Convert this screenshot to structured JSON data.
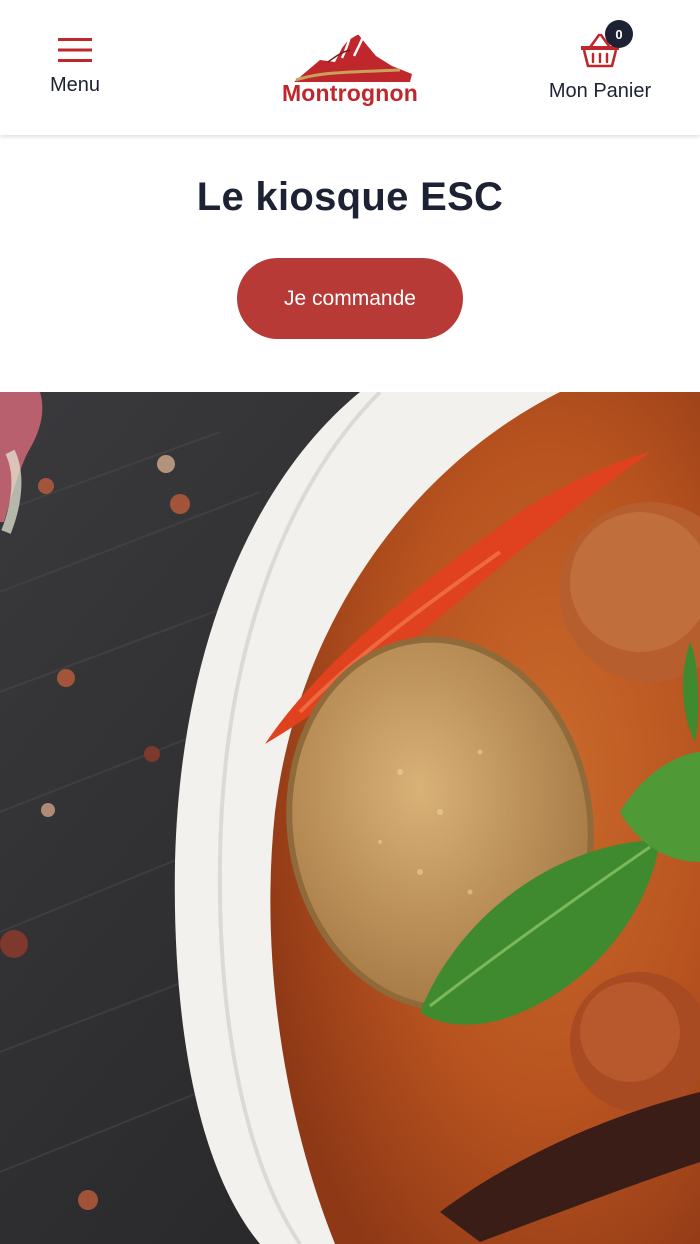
{
  "header": {
    "menu_label": "Menu",
    "logo_text": "Montrognon",
    "cart_label": "Mon Panier",
    "cart_count": "0",
    "icons": {
      "menu": "hamburger-icon",
      "cart": "basket-icon"
    }
  },
  "main": {
    "title": "Le kiosque ESC",
    "order_button_label": "Je commande"
  },
  "colors": {
    "brand_red": "#c0272d",
    "button_red": "#b83a37",
    "text_dark": "#1c2233",
    "badge_bg": "#1c2233"
  }
}
